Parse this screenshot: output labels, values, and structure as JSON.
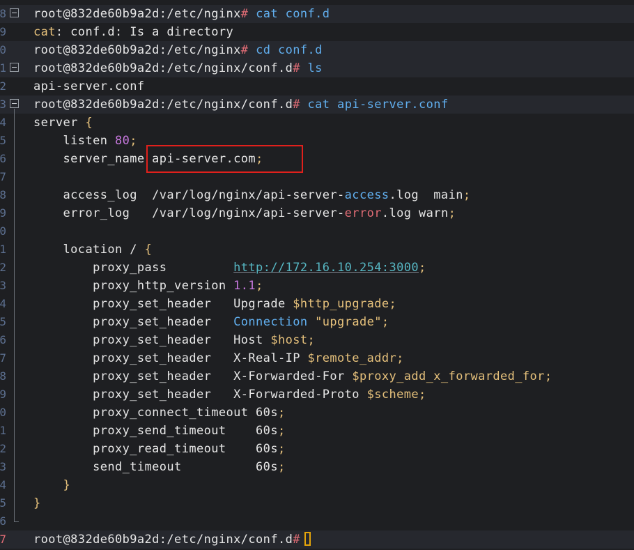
{
  "terminal": {
    "lines": [
      {
        "num": "8",
        "prompt": "root@832de60b9a2d:/etc/nginx",
        "hash": "#",
        "cmd": "cat conf.d"
      },
      {
        "num": "9",
        "out_a": "cat",
        "out_b": ": conf.d: Is a directory"
      },
      {
        "num": "0",
        "prompt": "root@832de60b9a2d:/etc/nginx",
        "hash": "#",
        "cmd": "cd conf.d"
      },
      {
        "num": "1",
        "prompt": "root@832de60b9a2d:/etc/nginx/conf.d",
        "hash": "#",
        "cmd": "ls"
      },
      {
        "num": "2",
        "out": "api-server.conf"
      },
      {
        "num": "3",
        "prompt": "root@832de60b9a2d:/etc/nginx/conf.d",
        "hash": "#",
        "cmd": "cat api-server.conf"
      },
      {
        "num": "4",
        "a": "server ",
        "b": "{"
      },
      {
        "num": "5",
        "a": "    listen ",
        "b": "80",
        "c": ";"
      },
      {
        "num": "6",
        "a": "    server_name ",
        "b": "api-server.com",
        "c": ";"
      },
      {
        "num": "7"
      },
      {
        "num": "8",
        "a": "    access_log  /var/log/nginx/api-server-",
        "b": "access",
        "c": ".log  main",
        "d": ";"
      },
      {
        "num": "9",
        "a": "    error_log   /var/log/nginx/api-server-",
        "b": "error",
        "c": ".log warn",
        "d": ";"
      },
      {
        "num": "0"
      },
      {
        "num": "1",
        "a": "    location / ",
        "b": "{"
      },
      {
        "num": "2",
        "a": "        proxy_pass         ",
        "b": "http://172.16.10.254:3000",
        "c": ";"
      },
      {
        "num": "3",
        "a": "        proxy_http_version ",
        "b": "1.1",
        "c": ";"
      },
      {
        "num": "4",
        "a": "        proxy_set_header   Upgrade ",
        "b": "$http_upgrade",
        "c": ";"
      },
      {
        "num": "5",
        "a": "        proxy_set_header   ",
        "b": "Connection",
        "c": " \"upgrade\"",
        "d": ";"
      },
      {
        "num": "6",
        "a": "        proxy_set_header   Host ",
        "b": "$host",
        "c": ";"
      },
      {
        "num": "7",
        "a": "        proxy_set_header   X-Real-IP ",
        "b": "$remote_addr",
        "c": ";"
      },
      {
        "num": "8",
        "a": "        proxy_set_header   X-Forwarded-For ",
        "b": "$proxy_add_x_forwarded_for",
        "c": ";"
      },
      {
        "num": "9",
        "a": "        proxy_set_header   X-Forwarded-Proto ",
        "b": "$scheme",
        "c": ";"
      },
      {
        "num": "0",
        "a": "        proxy_connect_timeout 60s",
        "b": ";"
      },
      {
        "num": "1",
        "a": "        proxy_send_timeout    60s",
        "b": ";"
      },
      {
        "num": "2",
        "a": "        proxy_read_timeout    60s",
        "b": ";"
      },
      {
        "num": "3",
        "a": "        send_timeout          60s",
        "b": ";"
      },
      {
        "num": "4",
        "a": "    ",
        "b": "}"
      },
      {
        "num": "5",
        "b": "}"
      },
      {
        "num": "6"
      },
      {
        "num": "7",
        "prompt": "root@832de60b9a2d:/etc/nginx/conf.d",
        "hash": "#"
      }
    ]
  },
  "colors": {
    "background": "#1e1f22",
    "highlight_box": "#e0201c",
    "cursor": "#e5a50a"
  }
}
